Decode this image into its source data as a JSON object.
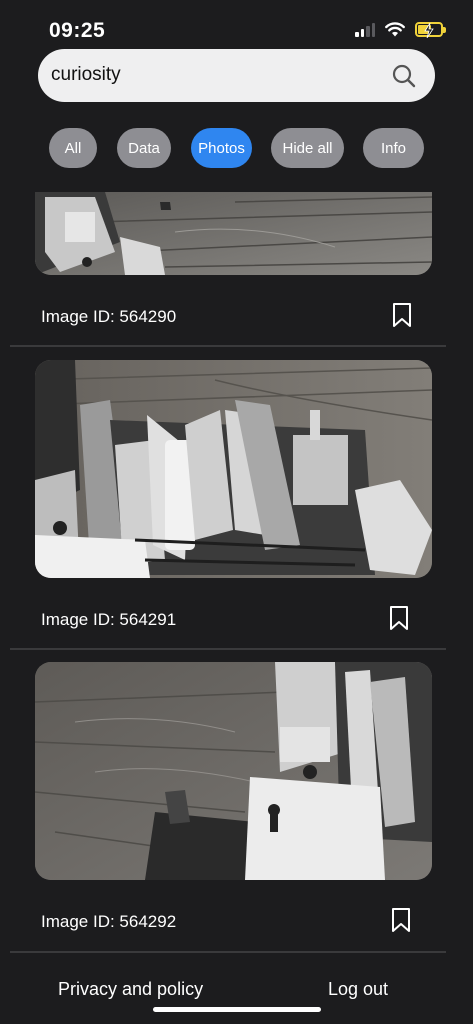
{
  "status_bar": {
    "time": "09:25"
  },
  "search": {
    "value": "curiosity"
  },
  "filters": [
    {
      "label": "All",
      "active": false
    },
    {
      "label": "Data",
      "active": false
    },
    {
      "label": "Photos",
      "active": true
    },
    {
      "label": "Hide all",
      "active": false
    },
    {
      "label": "Info",
      "active": false
    }
  ],
  "photos": [
    {
      "label": "Image ID: 564290"
    },
    {
      "label": "Image ID: 564291"
    },
    {
      "label": "Image ID: 564292"
    }
  ],
  "footer": {
    "privacy_label": "Privacy and policy",
    "logout_label": "Log out"
  },
  "colors": {
    "background": "#1c1c1e",
    "active_chip": "#2f86f0",
    "inactive_chip": "#8e8e93",
    "search_bg": "#efeff0",
    "battery": "#f0d23a"
  }
}
